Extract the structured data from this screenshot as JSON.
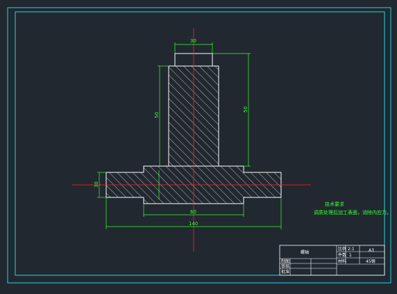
{
  "dimensions": {
    "top_width": "30",
    "height_inner": "50",
    "height_outer": "50",
    "flange_thickness": "30",
    "hub_width": "60",
    "total_width": "140"
  },
  "technical_requirements": {
    "heading": "技术要求",
    "text": "调质处理后加工表面，消除内应力。"
  },
  "title_block": {
    "part_name": "螺轴",
    "scale_label": "比例",
    "scale_value": "2:1",
    "quantity_label": "件数",
    "quantity_value": "1",
    "sheet_size": "A3",
    "material_label": "材料",
    "material_value": "45钢",
    "drawn_by_label": "制图",
    "checked_by_label": "审核",
    "approved_by_label": "批准"
  }
}
